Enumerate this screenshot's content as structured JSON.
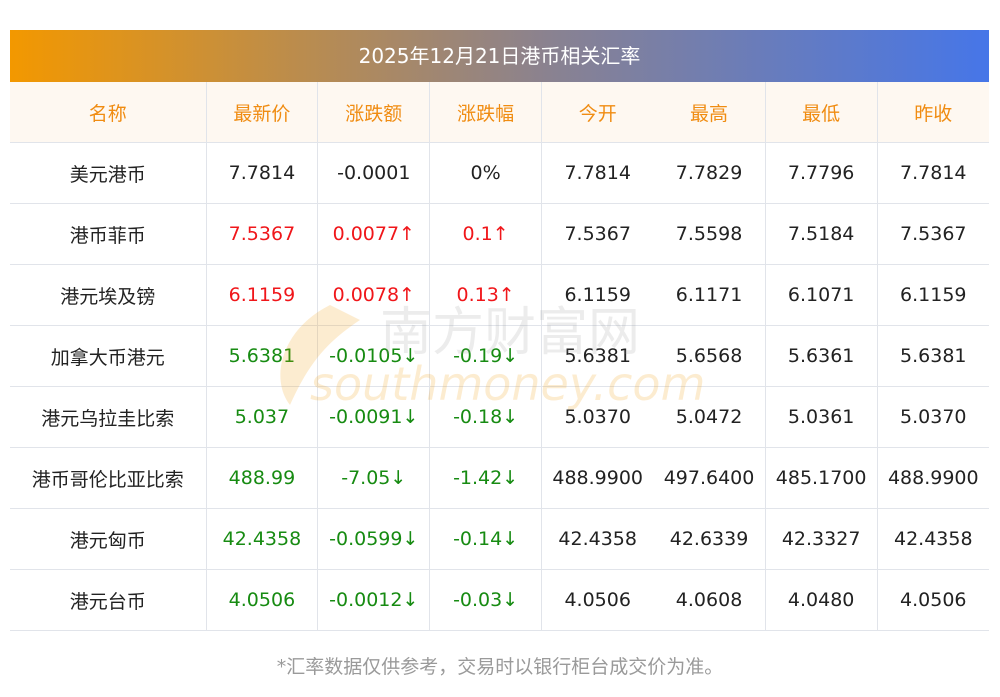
{
  "title": "2025年12月21日港币相关汇率",
  "headers": [
    "名称",
    "最新价",
    "涨跌额",
    "涨跌幅",
    "今开",
    "最高",
    "最低",
    "昨收"
  ],
  "rows": [
    {
      "name": "美元港币",
      "latest": "7.7814",
      "change": "-0.0001",
      "pct": "0%",
      "open": "7.7814",
      "high": "7.7829",
      "low": "7.7796",
      "prev": "7.7814",
      "trend": "flat"
    },
    {
      "name": "港币菲币",
      "latest": "7.5367",
      "change": "0.0077↑",
      "pct": "0.1↑",
      "open": "7.5367",
      "high": "7.5598",
      "low": "7.5184",
      "prev": "7.5367",
      "trend": "up"
    },
    {
      "name": "港元埃及镑",
      "latest": "6.1159",
      "change": "0.0078↑",
      "pct": "0.13↑",
      "open": "6.1159",
      "high": "6.1171",
      "low": "6.1071",
      "prev": "6.1159",
      "trend": "up"
    },
    {
      "name": "加拿大币港元",
      "latest": "5.6381",
      "change": "-0.0105↓",
      "pct": "-0.19↓",
      "open": "5.6381",
      "high": "5.6568",
      "low": "5.6361",
      "prev": "5.6381",
      "trend": "down"
    },
    {
      "name": "港元乌拉圭比索",
      "latest": "5.037",
      "change": "-0.0091↓",
      "pct": "-0.18↓",
      "open": "5.0370",
      "high": "5.0472",
      "low": "5.0361",
      "prev": "5.0370",
      "trend": "down"
    },
    {
      "name": "港币哥伦比亚比索",
      "latest": "488.99",
      "change": "-7.05↓",
      "pct": "-1.42↓",
      "open": "488.9900",
      "high": "497.6400",
      "low": "485.1700",
      "prev": "488.9900",
      "trend": "down"
    },
    {
      "name": "港元匈币",
      "latest": "42.4358",
      "change": "-0.0599↓",
      "pct": "-0.14↓",
      "open": "42.4358",
      "high": "42.6339",
      "low": "42.3327",
      "prev": "42.4358",
      "trend": "down"
    },
    {
      "name": "港元台币",
      "latest": "4.0506",
      "change": "-0.0012↓",
      "pct": "-0.03↓",
      "open": "4.0506",
      "high": "4.0608",
      "low": "4.0480",
      "prev": "4.0506",
      "trend": "down"
    }
  ],
  "watermark": {
    "cn": "南方财富网",
    "en": "southmoney.com"
  },
  "footer": "*汇率数据仅供参考，交易时以银行柜台成交价为准。",
  "colors": {
    "up": "#f0161a",
    "down": "#178b12",
    "header": "#f08c12"
  }
}
